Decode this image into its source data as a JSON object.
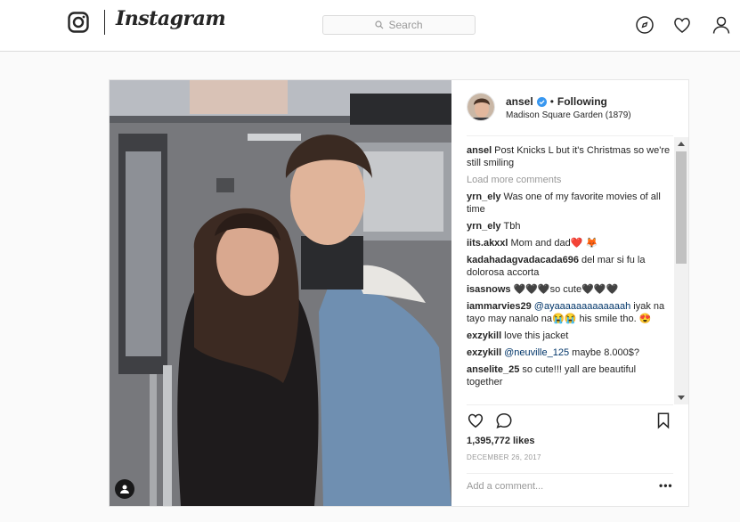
{
  "nav": {
    "logo_text": "Instagram",
    "search_placeholder": "Search"
  },
  "post": {
    "username": "ansel",
    "separator": "•",
    "follow_status": "Following",
    "location": "Madison Square Garden (1879)",
    "caption": {
      "user": "ansel",
      "text": "Post Knicks L but it's Christmas so we're still smiling"
    },
    "load_more": "Load more comments",
    "comments": [
      {
        "user": "yrn_ely",
        "text": "Was one of my favorite movies of all time"
      },
      {
        "user": "yrn_ely",
        "text": "Tbh"
      },
      {
        "user": "iits.akxxl",
        "text": "Mom and dad❤️ 🦊"
      },
      {
        "user": "kadahadagvadacada696",
        "text": "del mar si fu la dolorosa accorta"
      },
      {
        "user": "isasnows",
        "text": "🖤🖤🖤so cute🖤🖤🖤"
      },
      {
        "user": "iammarvies29",
        "mention": "@ayaaaaaaaaaaaaah",
        "text": "iyak na tayo may nanalo na😭😭 his smile tho. 😍"
      },
      {
        "user": "exzykill",
        "text": "love this jacket"
      },
      {
        "user": "exzykill",
        "mention": "@neuville_125",
        "text": "maybe 8.000$?"
      },
      {
        "user": "anselite_25",
        "text": "so cute!!! yall are beautiful together"
      }
    ],
    "likes": "1,395,772 likes",
    "date": "DECEMBER 26, 2017",
    "add_comment_placeholder": "Add a comment...",
    "more_options": "•••"
  },
  "colors": {
    "verified": "#3897f0",
    "border": "#dbdbdb",
    "muted": "#999999"
  },
  "icons": [
    "camera-logo-icon",
    "search-icon",
    "compass-icon",
    "heart-icon",
    "profile-icon",
    "verified-badge-icon",
    "tag-user-icon",
    "like-heart-icon",
    "comment-bubble-icon",
    "bookmark-icon"
  ]
}
